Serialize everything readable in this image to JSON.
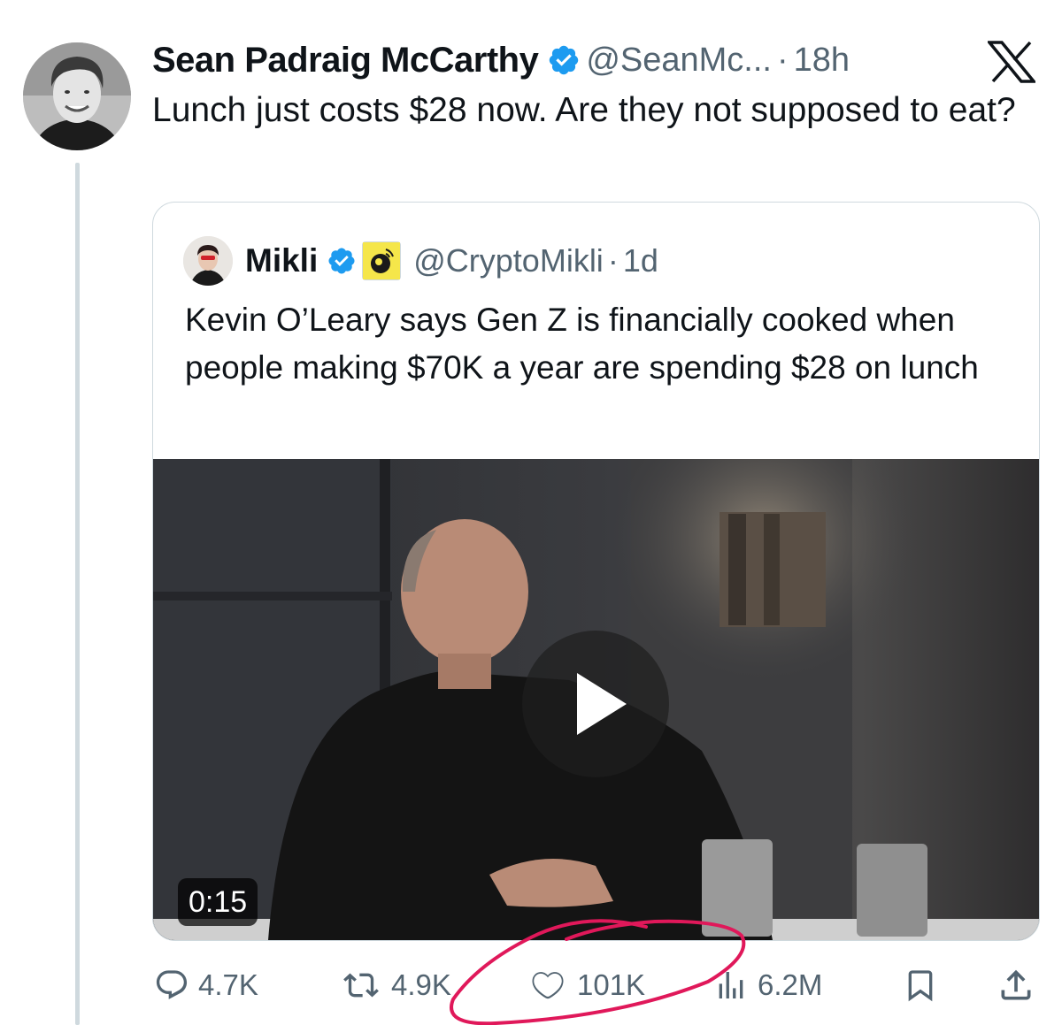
{
  "tweet": {
    "author_name": "Sean Padraig McCarthy",
    "author_handle": "@SeanMc...",
    "separator": "·",
    "time": "18h",
    "text": "Lunch just costs $28 now. Are they not supposed to eat?"
  },
  "quoted_tweet": {
    "author_name": "Mikli",
    "author_handle": "@CryptoMikli",
    "separator": "·",
    "time": "1d",
    "text": "Kevin O’Leary says Gen Z is financially cooked when people making $70K a year are spending $28 on lunch",
    "video": {
      "duration": "0:15"
    }
  },
  "actions": {
    "replies": "4.7K",
    "reposts": "4.9K",
    "likes": "101K",
    "views": "6.2M"
  },
  "colors": {
    "text": "#0f1419",
    "secondary": "#536471",
    "verified": "#1d9bf0",
    "border": "#cfd9de",
    "annotation": "#e0185a"
  },
  "icons": [
    "x-logo-icon",
    "verified-badge-icon",
    "affiliate-badge-icon",
    "reply-icon",
    "repost-icon",
    "like-icon",
    "views-icon",
    "bookmark-icon",
    "share-icon",
    "play-icon"
  ]
}
